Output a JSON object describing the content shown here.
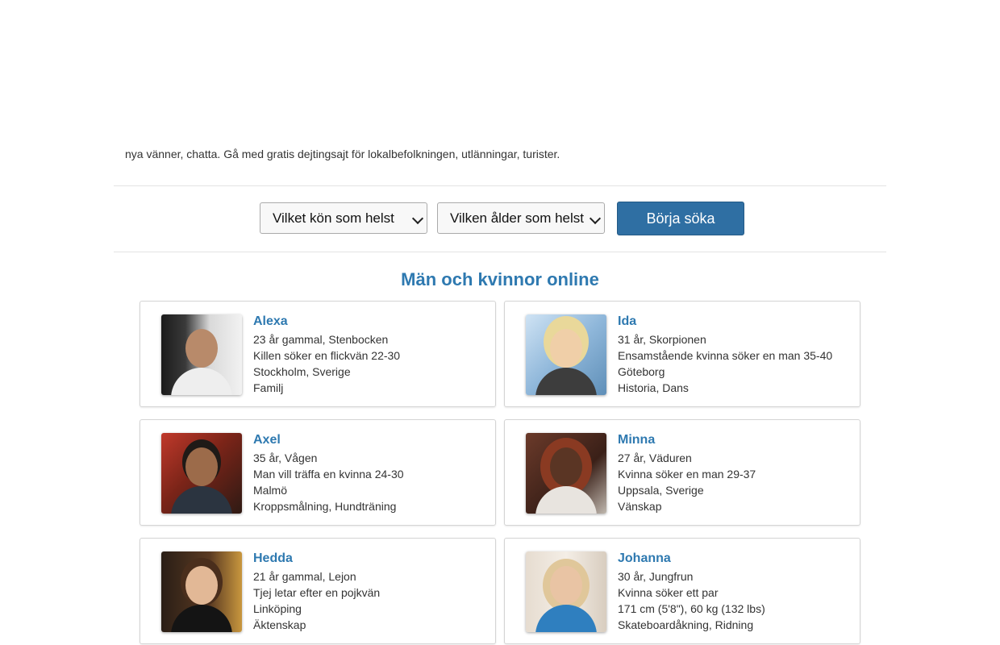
{
  "intro": {
    "text": "nya vänner, chatta. Gå med gratis dejtingsajt för lokalbefolkningen, utlänningar, turister."
  },
  "search": {
    "gender_select": "Vilket kön som helst",
    "age_select": "Vilken ålder som helst",
    "button_label": "Börja söka"
  },
  "section": {
    "title": "Män och kvinnor online"
  },
  "profiles": [
    {
      "name": "Alexa",
      "age_sign": "23 år gammal, Stenbocken",
      "seeking": "Killen söker en flickvän 22-30",
      "location": "Stockholm, Sverige",
      "interests": "Familj"
    },
    {
      "name": "Ida",
      "age_sign": "31 år, Skorpionen",
      "seeking": "Ensamstående kvinna söker en man 35-40",
      "location": "Göteborg",
      "interests": "Historia, Dans"
    },
    {
      "name": "Axel",
      "age_sign": "35 år, Vågen",
      "seeking": "Man vill träffa en kvinna 24-30",
      "location": "Malmö",
      "interests": "Kroppsmålning, Hundträning"
    },
    {
      "name": "Minna",
      "age_sign": "27 år, Väduren",
      "seeking": "Kvinna söker en man 29-37",
      "location": "Uppsala, Sverige",
      "interests": "Vänskap"
    },
    {
      "name": "Hedda",
      "age_sign": "21 år gammal, Lejon",
      "seeking": "Tjej letar efter en pojkvän",
      "location": "Linköping",
      "interests": "Äktenskap"
    },
    {
      "name": "Johanna",
      "age_sign": "30 år, Jungfrun",
      "seeking": "Kvinna söker ett par",
      "location": "171 cm (5'8\"), 60 kg (132 lbs)",
      "interests": "Skateboardåkning, Ridning"
    }
  ]
}
